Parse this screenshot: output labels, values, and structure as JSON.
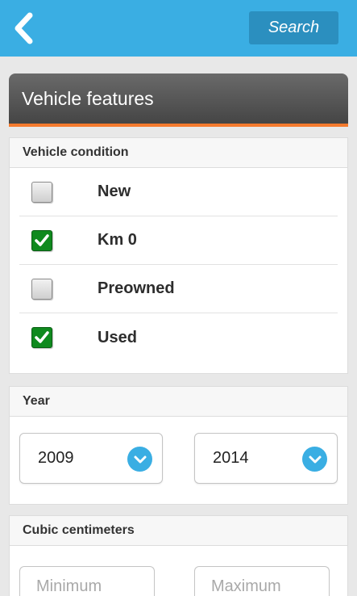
{
  "topbar": {
    "search_label": "Search",
    "accent_color": "#3aaee3"
  },
  "features": {
    "title": "Vehicle features",
    "accent_color": "#f47a2d"
  },
  "condition": {
    "title": "Vehicle condition",
    "options": [
      {
        "label": "New",
        "checked": false
      },
      {
        "label": "Km 0",
        "checked": true
      },
      {
        "label": "Preowned",
        "checked": false
      },
      {
        "label": "Used",
        "checked": true
      }
    ]
  },
  "year": {
    "title": "Year",
    "from_value": "2009",
    "to_value": "2014"
  },
  "cc": {
    "title": "Cubic centimeters",
    "min_placeholder": "Minimum",
    "max_placeholder": "Maximum"
  }
}
